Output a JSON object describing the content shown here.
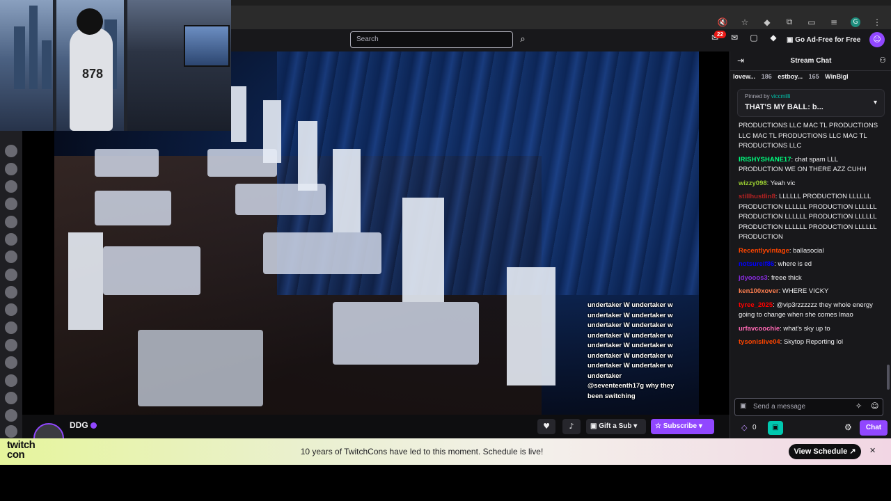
{
  "topnav": {
    "search_placeholder": "Search",
    "notification_count": "22",
    "ad_free_label": "Go Ad-Free for Free"
  },
  "video": {
    "overlay_lines": [
      "undertaker W undertaker w",
      "undertaker W undertaker w",
      "undertaker W undertaker w",
      "undertaker W undertaker w",
      "undertaker W undertaker w",
      "undertaker W undertaker w",
      "undertaker W undertaker w",
      "undertaker",
      "@seventeenth17g why they been switching"
    ],
    "jersey_number": "878"
  },
  "stream": {
    "streamer_name": "DDG",
    "heart_icon": "heart-icon",
    "gift_label": "Gift a Sub",
    "subscribe_label": "Subscribe"
  },
  "chat": {
    "title": "Stream Chat",
    "leaderboard": [
      {
        "name": "lovew...",
        "count": ""
      },
      {
        "name": "",
        "count": "186"
      },
      {
        "name": "estboy...",
        "count": "165"
      },
      {
        "name": "WinBigl",
        "count": ""
      }
    ],
    "pinned_by": "Pinned by",
    "pinned_user": "viccmilli",
    "pinned_message": "THAT'S MY BALL: b...",
    "messages": [
      {
        "user": "",
        "color": "#efeff1",
        "text": "PRODUCTIONS LLC MAC TL PRODUCTIONS LLC MAC TL PRODUCTIONS LLC MAC TL PRODUCTIONS LLC"
      },
      {
        "user": "IRISHYSHANE17",
        "color": "#00ff7f",
        "text": ": chat spam LLL PRODUCTION WE ON THERE AZZ CUHH"
      },
      {
        "user": "wizzy098",
        "color": "#9acd32",
        "text": ": Yeah vic"
      },
      {
        "user": "stillhustlin8",
        "color": "#b22222",
        "text": ": LLLLLL PRODUCTION LLLLLL PRODUCTION LLLLLL PRODUCTION LLLLLL PRODUCTION LLLLLL PRODUCTION LLLLLL PRODUCTION LLLLLL PRODUCTION LLLLLL PRODUCTION"
      },
      {
        "user": "Recentlyvintage",
        "color": "#ff4500",
        "text": ": ballasocial"
      },
      {
        "user": "notsureif86",
        "color": "#0000ff",
        "text": ": where is ed"
      },
      {
        "user": "jdyooos3",
        "color": "#8a2be2",
        "text": ": freee thick"
      },
      {
        "user": "ken100xover",
        "color": "#ff7f50",
        "text": ": WHERE VICKY"
      },
      {
        "user": "tyree_2025",
        "color": "#ff0000",
        "text": ": @vip3rzzzzzz they whole energy going to change when she comes lmao"
      },
      {
        "user": "urfavcoochie",
        "color": "#ff69b4",
        "text": ": what's sky up to"
      },
      {
        "user": "tysonislive04",
        "color": "#ff4500",
        "text": ": Skytop Reporting lol"
      }
    ],
    "input_placeholder": "Send a message",
    "points": "0",
    "chat_button": "Chat"
  },
  "banner": {
    "logo_line1": "twitch",
    "logo_line2": "con",
    "text": "10 years of TwitchCons have led to this moment. Schedule is live!",
    "button": "View Schedule ↗",
    "close": "✕"
  }
}
